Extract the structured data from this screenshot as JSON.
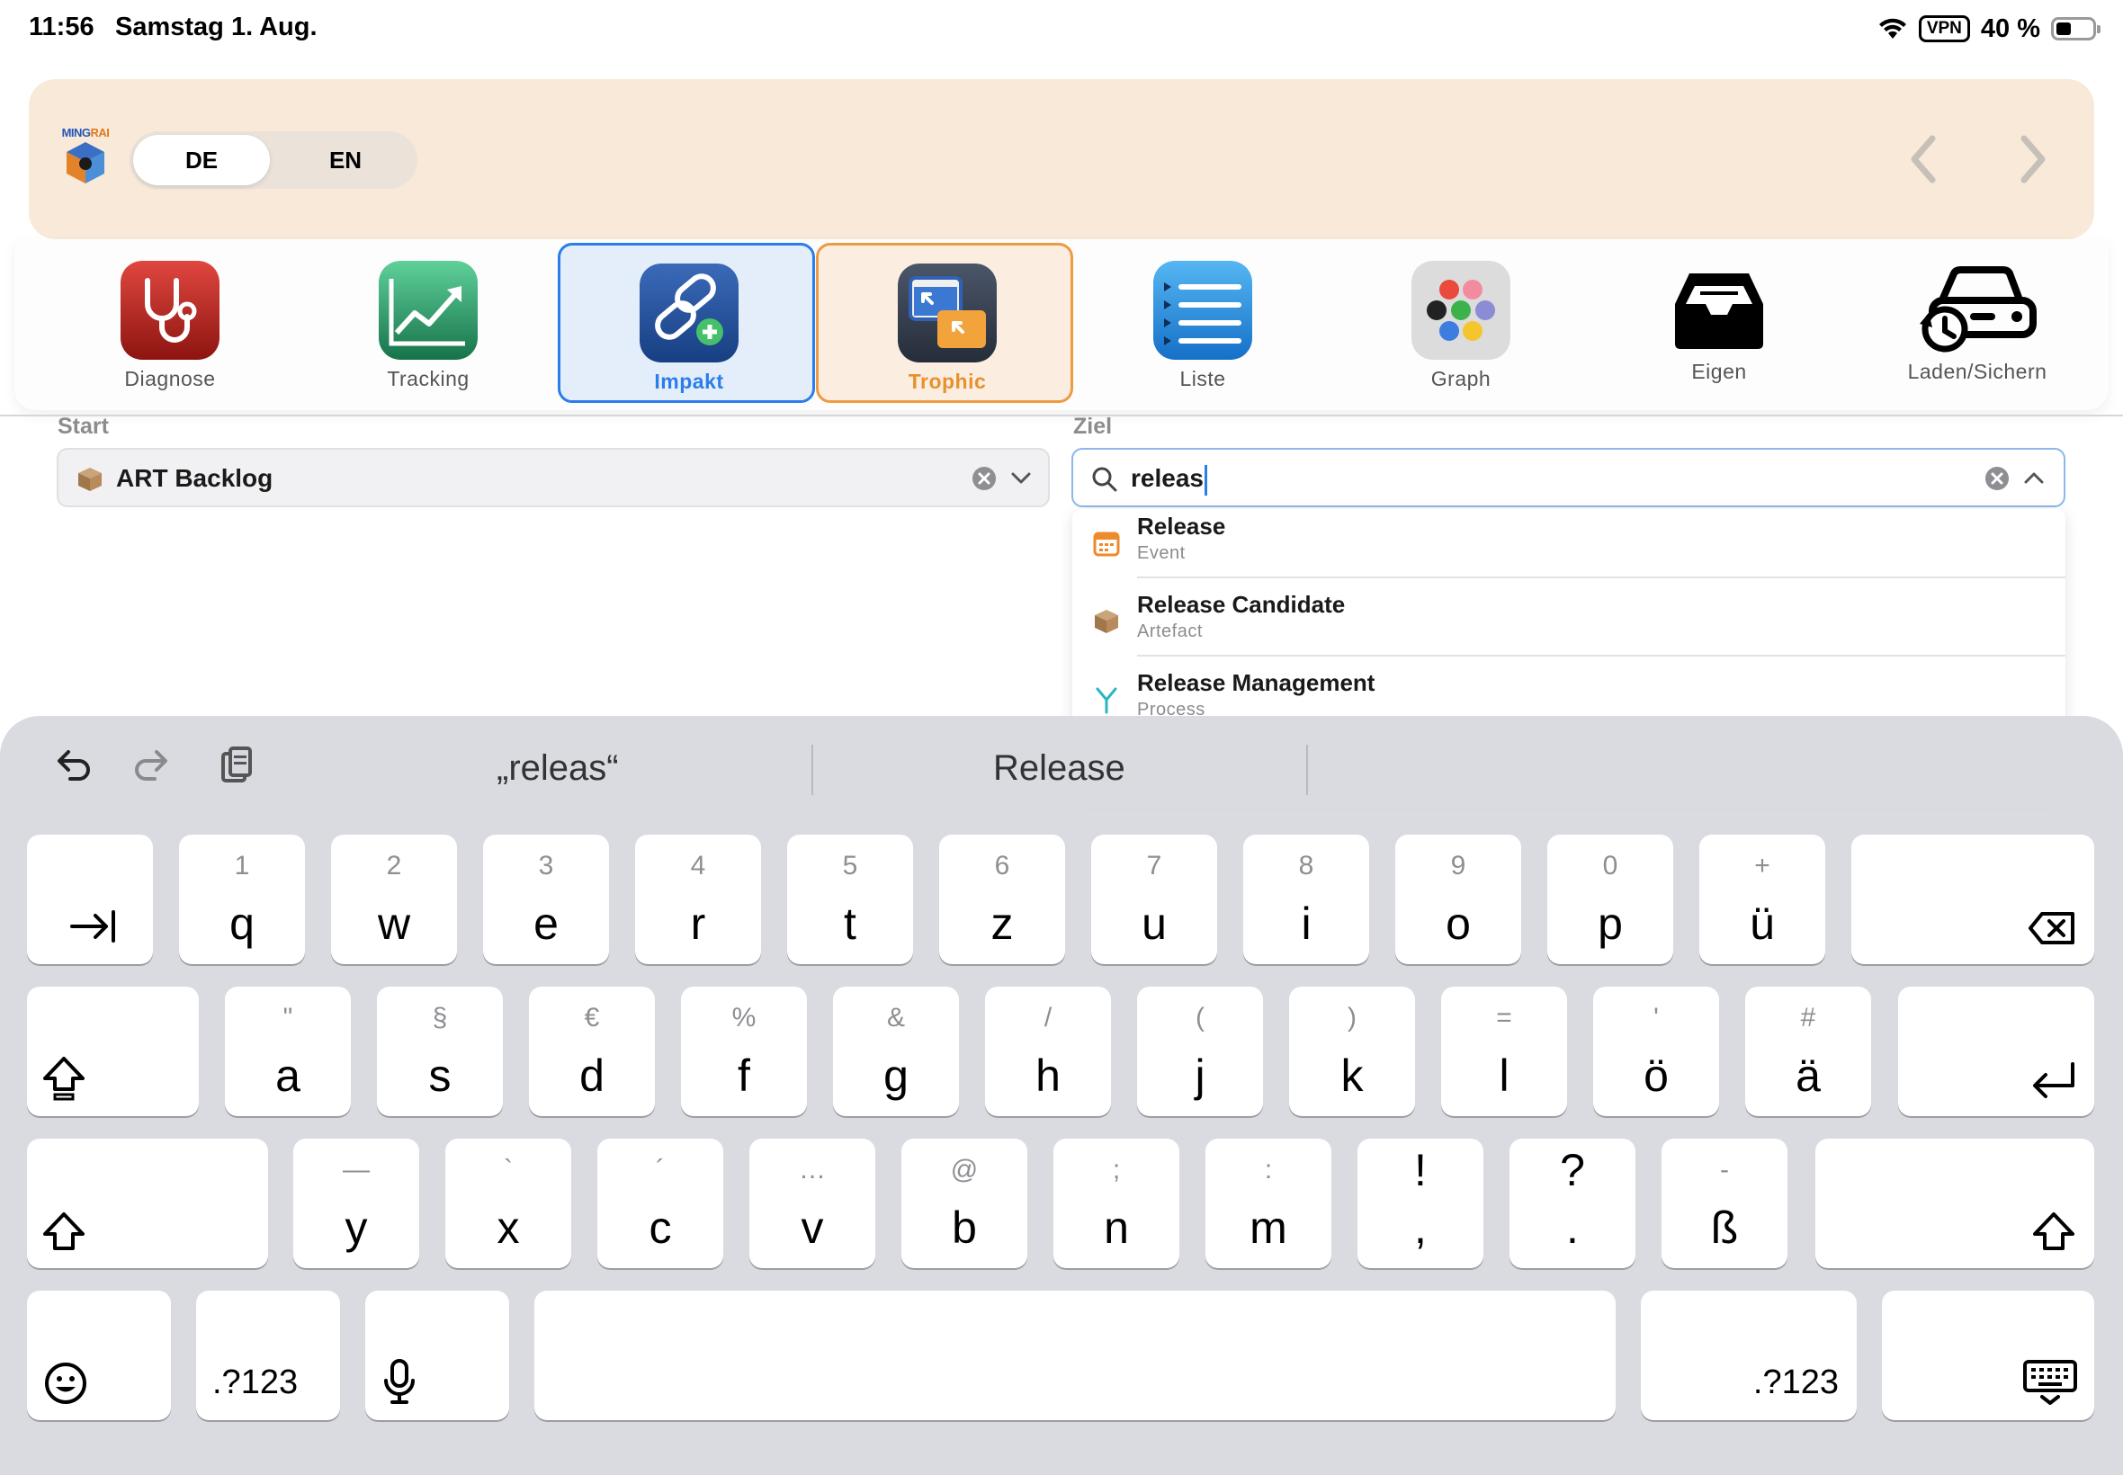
{
  "status_bar": {
    "time": "11:56",
    "date": "Samstag 1. Aug.",
    "vpn": "VPN",
    "battery": "40 %"
  },
  "header": {
    "logo_text_a": "MING",
    "logo_text_b": "RAI",
    "lang": {
      "de": "DE",
      "en": "EN",
      "selected": "DE"
    }
  },
  "toolbar": {
    "items": [
      {
        "label": "Diagnose",
        "icon": "stethoscope-icon"
      },
      {
        "label": "Tracking",
        "icon": "trend-chart-icon"
      },
      {
        "label": "Impakt",
        "icon": "link-plus-icon",
        "active": true
      },
      {
        "label": "Trophic",
        "icon": "windows-arrows-icon",
        "active": true
      },
      {
        "label": "Liste",
        "icon": "list-icon"
      },
      {
        "label": "Graph",
        "icon": "color-dots-icon"
      },
      {
        "label": "Eigen",
        "icon": "tray-icon"
      },
      {
        "label": "Laden/Sichern",
        "icon": "car-restore-icon"
      }
    ]
  },
  "form": {
    "start_label": "Start",
    "start_value": "ART Backlog",
    "ziel_label": "Ziel",
    "ziel_value": "releas"
  },
  "dropdown": {
    "items": [
      {
        "title": "Release",
        "type": "Event"
      },
      {
        "title": "Release Candidate",
        "type": "Artefact"
      },
      {
        "title": "Release Management",
        "type": "Process"
      }
    ]
  },
  "keyboard": {
    "suggestions": [
      "„releas“",
      "Release"
    ],
    "row1": [
      {
        "main": "q",
        "alt": "1"
      },
      {
        "main": "w",
        "alt": "2"
      },
      {
        "main": "e",
        "alt": "3"
      },
      {
        "main": "r",
        "alt": "4"
      },
      {
        "main": "t",
        "alt": "5"
      },
      {
        "main": "z",
        "alt": "6"
      },
      {
        "main": "u",
        "alt": "7"
      },
      {
        "main": "i",
        "alt": "8"
      },
      {
        "main": "o",
        "alt": "9"
      },
      {
        "main": "p",
        "alt": "0"
      },
      {
        "main": "ü",
        "alt": "+"
      }
    ],
    "row2": [
      {
        "main": "a",
        "alt": "\""
      },
      {
        "main": "s",
        "alt": "§"
      },
      {
        "main": "d",
        "alt": "€"
      },
      {
        "main": "f",
        "alt": "%"
      },
      {
        "main": "g",
        "alt": "&"
      },
      {
        "main": "h",
        "alt": "/"
      },
      {
        "main": "j",
        "alt": "("
      },
      {
        "main": "k",
        "alt": ")"
      },
      {
        "main": "l",
        "alt": "="
      },
      {
        "main": "ö",
        "alt": "'"
      },
      {
        "main": "ä",
        "alt": "#"
      }
    ],
    "row3": [
      {
        "main": "y",
        "alt": "—"
      },
      {
        "main": "x",
        "alt": "`"
      },
      {
        "main": "c",
        "alt": "´"
      },
      {
        "main": "v",
        "alt": "…"
      },
      {
        "main": "b",
        "alt": "@"
      },
      {
        "main": "n",
        "alt": ";"
      },
      {
        "main": "m",
        "alt": ":"
      },
      {
        "main": ",",
        "alt": "!"
      },
      {
        "main": ".",
        "alt": "?"
      },
      {
        "main": "ß",
        "alt": "-"
      }
    ],
    "numbers_label": ".?123"
  }
}
